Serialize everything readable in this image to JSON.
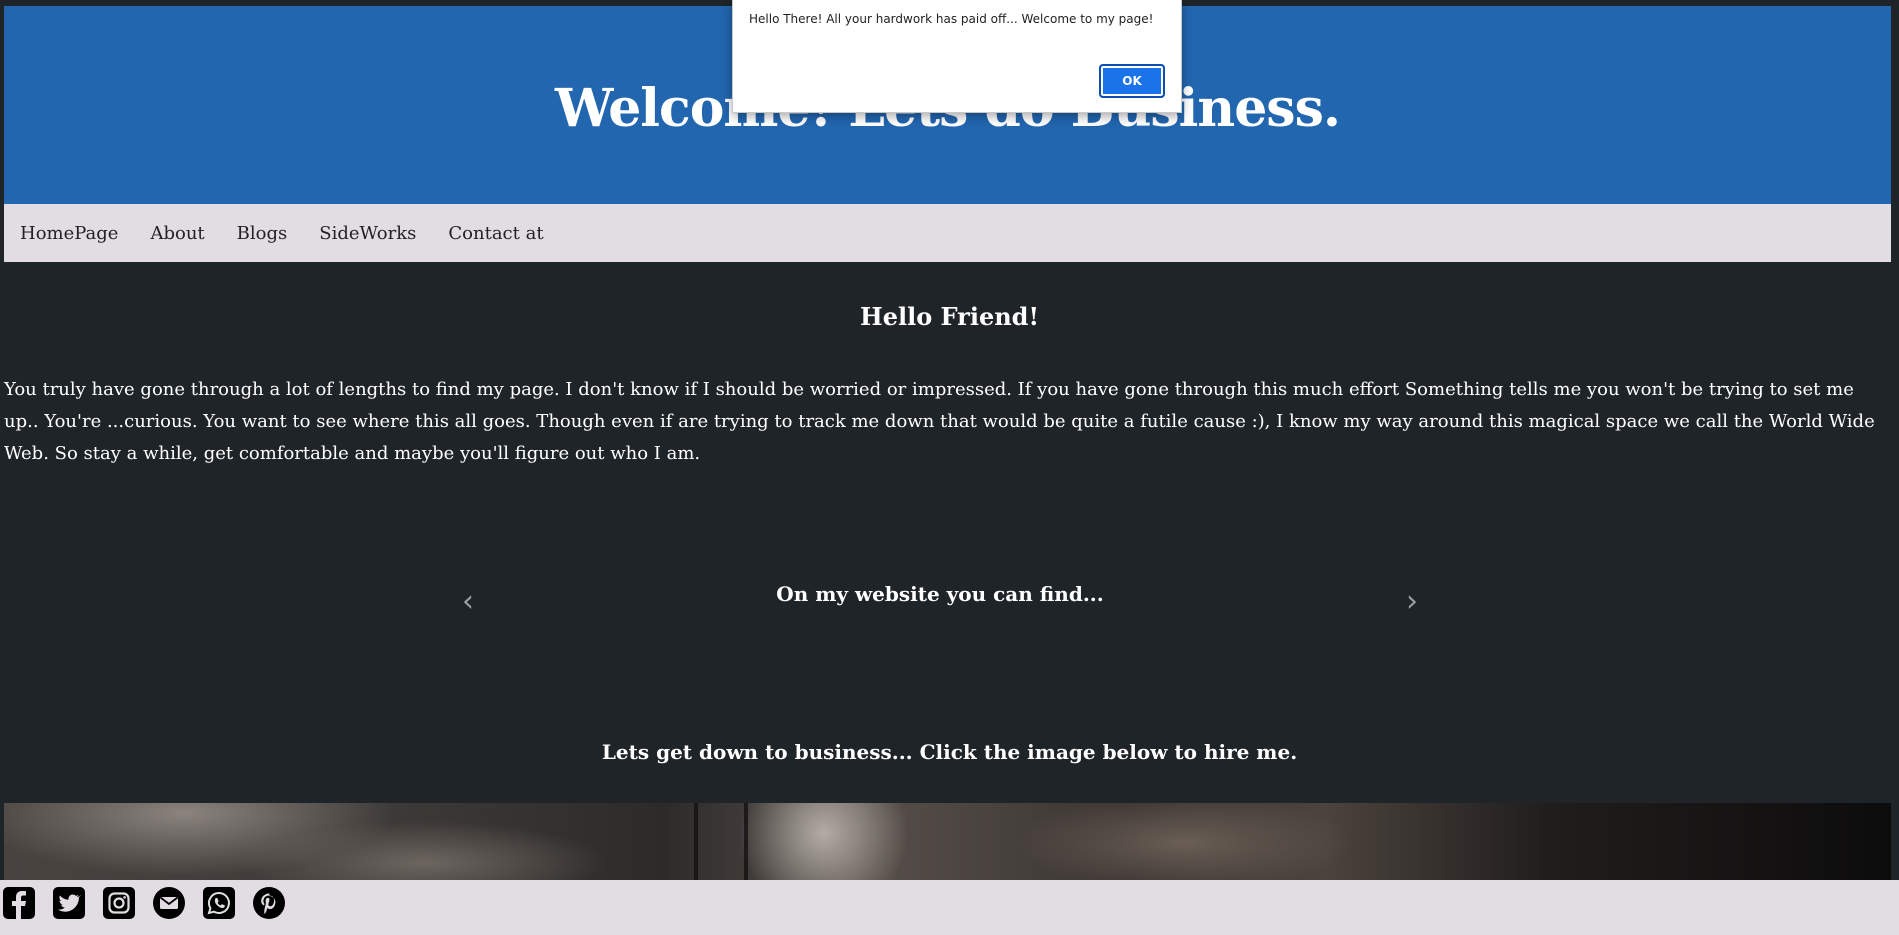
{
  "header": {
    "title": "Welcome! Lets do Business."
  },
  "nav": {
    "items": [
      "HomePage",
      "About",
      "Blogs",
      "SideWorks",
      "Contact at"
    ]
  },
  "main": {
    "greeting": "Hello Friend!",
    "intro": "You truly have gone through a lot of lengths to find my page. I don't know if I should be worried or impressed. If you have gone through this much effort Something tells me you won't be trying to set me up.. You're ...curious. You want to see where this all goes. Though even if are trying to track me down that would be quite a futile cause :), I know my way around this magical space we call the World Wide Web. So stay a while, get comfortable and maybe you'll figure out who I am.",
    "carousel": {
      "caption": "On my website you can find...",
      "prev": "‹",
      "next": "›"
    },
    "business": "Lets get down to business... Click the image below to hire me."
  },
  "footer": {
    "social_icons": [
      "facebook-icon",
      "twitter-icon",
      "instagram-icon",
      "email-icon",
      "whatsapp-icon",
      "pinterest-icon"
    ]
  },
  "alert": {
    "message": "Hello There! All your hardwork has paid off... Welcome to my page!",
    "ok_label": "OK"
  },
  "colors": {
    "header_bg": "#2266b0",
    "page_bg": "#1f2428",
    "nav_bg": "#e1dde2",
    "ok_button": "#1a73e8"
  }
}
